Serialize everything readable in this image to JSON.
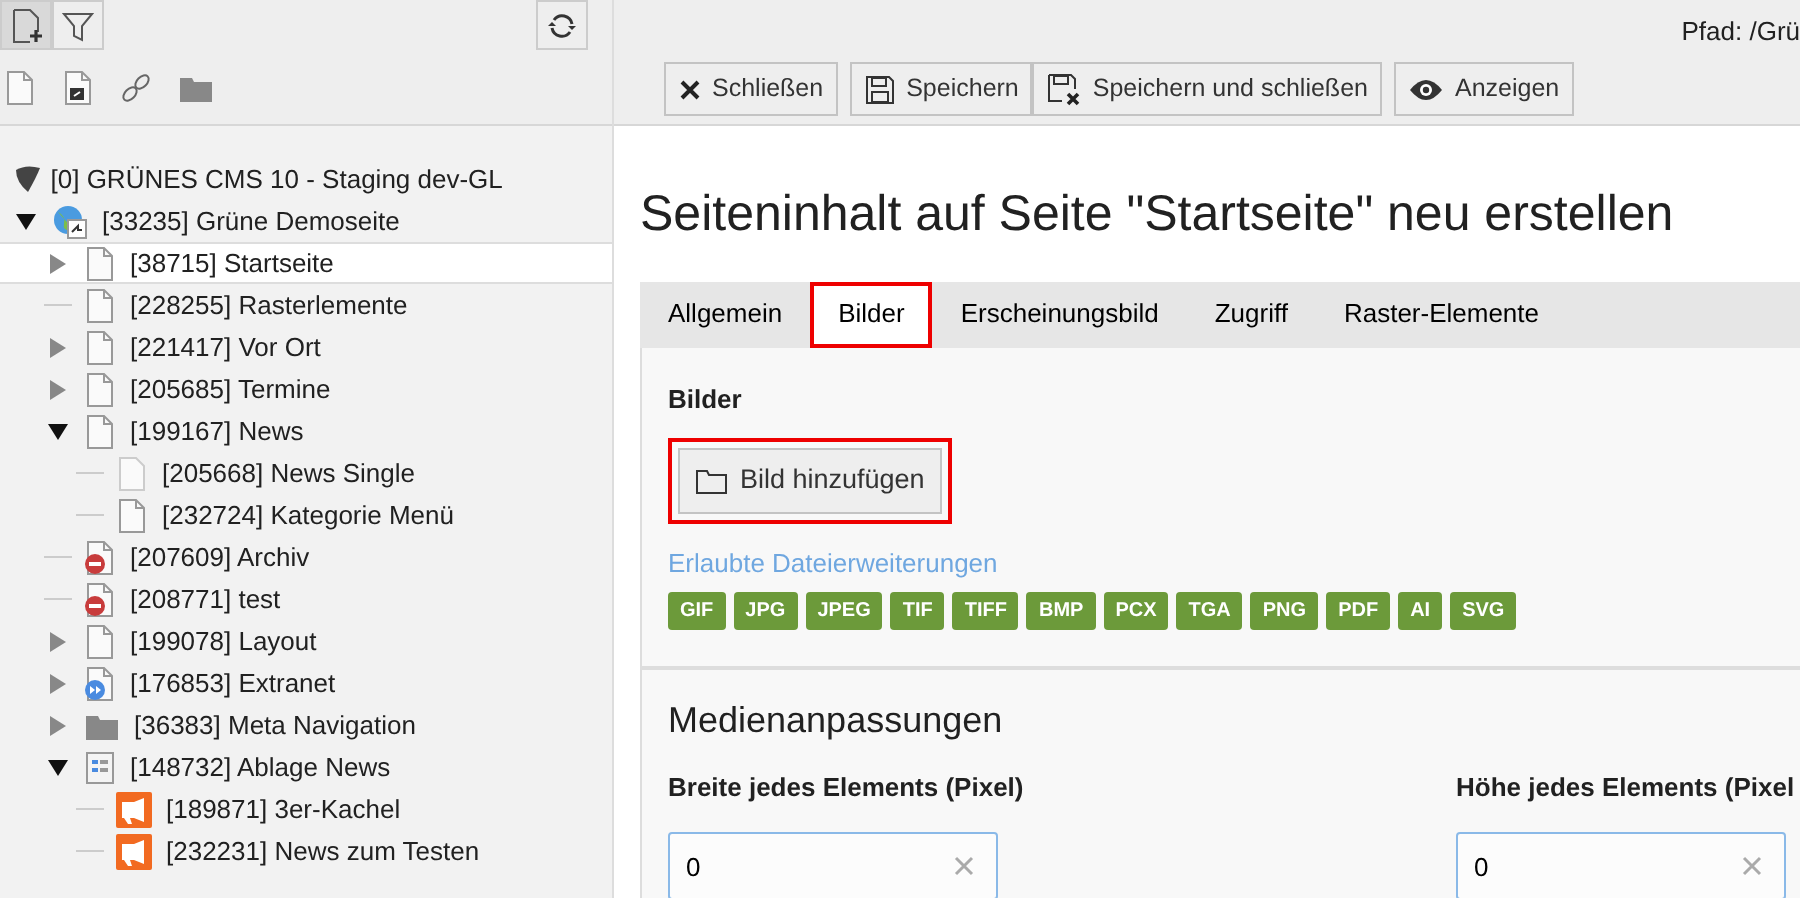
{
  "tree_toolbar": {
    "buttons": [
      {
        "kind": "new-page",
        "selected": true
      },
      {
        "kind": "filter",
        "selected": false
      }
    ]
  },
  "tree": {
    "root": "[0] GRÜNES CMS 10 - Staging dev-GL",
    "items": [
      {
        "label": "[33235] Grüne Demoseite",
        "kind": "site",
        "expanded": true,
        "selected": false,
        "children": [
          {
            "label": "[38715] Startseite",
            "kind": "page",
            "expanded": false,
            "selected": true
          },
          {
            "label": "[228255] Rasterlemente",
            "kind": "page",
            "selected": false
          },
          {
            "label": "[221417] Vor Ort",
            "kind": "page",
            "expanded": false,
            "selected": false
          },
          {
            "label": "[205685] Termine",
            "kind": "page",
            "expanded": false,
            "selected": false
          },
          {
            "label": "[199167] News",
            "kind": "page",
            "expanded": true,
            "selected": false,
            "children": [
              {
                "label": "[205668] News Single",
                "kind": "hidden-page",
                "selected": false
              },
              {
                "label": "[232724] Kategorie Menü",
                "kind": "page",
                "selected": false
              }
            ]
          },
          {
            "label": "[207609] Archiv",
            "kind": "disabled-page",
            "selected": false
          },
          {
            "label": "[208771] test",
            "kind": "disabled-page",
            "selected": false
          },
          {
            "label": "[199078] Layout",
            "kind": "page",
            "expanded": false,
            "selected": false
          },
          {
            "label": "[176853] Extranet",
            "kind": "shortcut",
            "expanded": false,
            "selected": false
          },
          {
            "label": "[36383] Meta Navigation",
            "kind": "folder",
            "expanded": false,
            "selected": false
          },
          {
            "label": "[148732] Ablage News",
            "kind": "sysfolder",
            "expanded": true,
            "selected": false,
            "children": [
              {
                "label": "[189871] 3er-Kachel",
                "kind": "news",
                "selected": false
              },
              {
                "label": "[232231] News zum Testen",
                "kind": "news",
                "selected": false
              }
            ]
          }
        ]
      }
    ]
  },
  "path": "Pfad: /Grü",
  "action_groups": [
    [
      {
        "label": "Schließen",
        "kind": "close"
      }
    ],
    [
      {
        "label": "Speichern",
        "kind": "save"
      },
      {
        "label": "Speichern und schließen",
        "kind": "save-close"
      }
    ],
    [
      {
        "label": "Anzeigen",
        "kind": "eye"
      }
    ]
  ],
  "title": "Seiteninhalt auf Seite \"Startseite\" neu erstellen",
  "tabs": [
    {
      "label": "Allgemein",
      "selected": false,
      "highlighted": false
    },
    {
      "label": "Bilder",
      "selected": true,
      "highlighted": true
    },
    {
      "label": "Erscheinungsbild",
      "selected": false,
      "highlighted": false
    },
    {
      "label": "Zugriff",
      "selected": false,
      "highlighted": false
    },
    {
      "label": "Raster-Elemente",
      "selected": false,
      "highlighted": false
    }
  ],
  "images": {
    "heading": "Bilder",
    "add_button": {
      "label": "Bild hinzufügen",
      "highlighted": true
    },
    "extensions_link": "Erlaubte Dateierweiterungen",
    "extensions": [
      "GIF",
      "JPG",
      "JPEG",
      "TIF",
      "TIFF",
      "BMP",
      "PCX",
      "TGA",
      "PNG",
      "PDF",
      "AI",
      "SVG"
    ]
  },
  "media": {
    "heading": "Medienanpassungen",
    "fields": [
      {
        "label": "Breite jedes Elements (Pixel)",
        "value": "0"
      },
      {
        "label": "Höhe jedes Elements (Pixel",
        "value": "0"
      }
    ]
  }
}
